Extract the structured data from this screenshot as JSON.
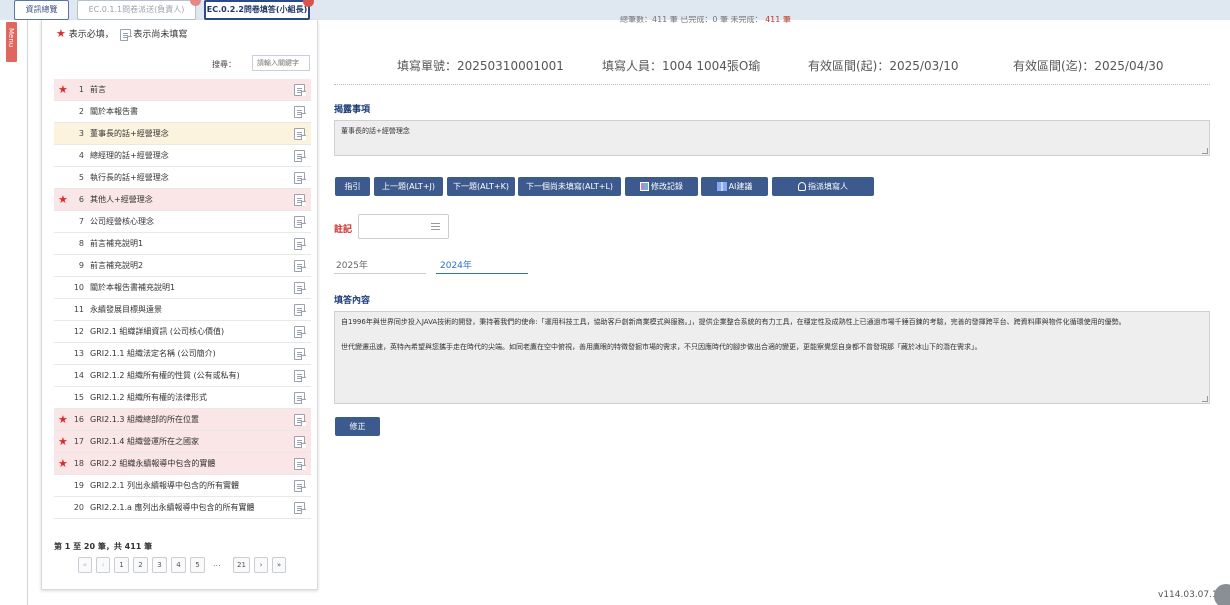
{
  "tabs": [
    {
      "label": "資訊總覽",
      "badge": false
    },
    {
      "label": "EC.0.1.1問卷派送(負責人)",
      "badge": true
    },
    {
      "label": "EC.0.2.2問卷填答(小組長)",
      "badge": true
    }
  ],
  "top_strip": {
    "text": "總筆數：411 筆 已完成：0 筆 未完成：",
    "red": "411 筆"
  },
  "menu_label": "Menu",
  "legend": {
    "required_label": "表示必填，",
    "unfilled_label": "表示尚未填寫"
  },
  "search": {
    "label": "搜尋：",
    "placeholder": "請輸入關鍵字"
  },
  "questions": [
    {
      "num": "1",
      "title": "前言",
      "required": true,
      "selected": false
    },
    {
      "num": "2",
      "title": "關於本報告書",
      "required": false,
      "selected": false
    },
    {
      "num": "3",
      "title": "董事長的話+經營理念",
      "required": false,
      "selected": true
    },
    {
      "num": "4",
      "title": "總經理的話+經營理念",
      "required": false,
      "selected": false
    },
    {
      "num": "5",
      "title": "執行長的話+經營理念",
      "required": false,
      "selected": false
    },
    {
      "num": "6",
      "title": "其他人+經營理念",
      "required": true,
      "selected": false
    },
    {
      "num": "7",
      "title": "公司經營核心理念",
      "required": false,
      "selected": false
    },
    {
      "num": "8",
      "title": "前言補充說明1",
      "required": false,
      "selected": false
    },
    {
      "num": "9",
      "title": "前言補充說明2",
      "required": false,
      "selected": false
    },
    {
      "num": "10",
      "title": "關於本報告書補充說明1",
      "required": false,
      "selected": false
    },
    {
      "num": "11",
      "title": "永續發展目標與遠景",
      "required": false,
      "selected": false
    },
    {
      "num": "12",
      "title": "GRI2.1 組織詳細資訊 (公司核心價值)",
      "required": false,
      "selected": false
    },
    {
      "num": "13",
      "title": "GRI2.1.1 組織法定名稱 (公司簡介)",
      "required": false,
      "selected": false
    },
    {
      "num": "14",
      "title": "GRI2.1.2 組織所有權的性質 (公有或私有)",
      "required": false,
      "selected": false
    },
    {
      "num": "15",
      "title": "GRI2.1.2 組織所有權的法律形式",
      "required": false,
      "selected": false
    },
    {
      "num": "16",
      "title": "GRI2.1.3 組織總部的所在位置",
      "required": true,
      "selected": false
    },
    {
      "num": "17",
      "title": "GRI2.1.4 組織營運所在之國家",
      "required": true,
      "selected": false
    },
    {
      "num": "18",
      "title": "GRI2.2 組織永續報導中包含的實體",
      "required": true,
      "selected": false
    },
    {
      "num": "19",
      "title": "GRI2.2.1 列出永續報導中包含的所有實體",
      "required": false,
      "selected": false
    },
    {
      "num": "20",
      "title": "GRI2.2.1.a 應列出永續報導中包含的所有實體",
      "required": false,
      "selected": false
    }
  ],
  "pager": {
    "info": "第 1 至 20 筆，共 411 筆",
    "first": "«",
    "prev": "‹",
    "pages": [
      "1",
      "2",
      "3",
      "4",
      "5"
    ],
    "ellipsis": "...",
    "last_page": "21",
    "next": "›",
    "last": "»"
  },
  "header_info": {
    "form_no": "填寫單號：20250310001001",
    "filler": "填寫人員：1004 1004張O瑜",
    "valid_from": "有效區間(起)：2025/03/10",
    "valid_to": "有效區間(迄)：2025/04/30"
  },
  "disclosure": {
    "title": "揭露事項",
    "text": "董事長的話+經營理念"
  },
  "buttons": {
    "guide": "指引",
    "prev": "上一題(ALT+J)",
    "next": "下一題(ALT+K)",
    "next_unfilled": "下一個尚未填寫(ALT+L)",
    "history": "修改記錄",
    "ai": "AI建議",
    "assign": "指派填寫人"
  },
  "note": {
    "label": "註記"
  },
  "year_tabs": [
    {
      "label": "2025年",
      "active": false
    },
    {
      "label": "2024年",
      "active": true
    }
  ],
  "answer": {
    "title": "填答內容",
    "paragraph1": "自1996年與世界同步投入JAVA技術的開發，秉持著我們的使命:「運用科技工具，協助客戶創新商業模式與服務。」，提供企業整合系統的有力工具，在穩定性及成熟性上已通過市場千錘百鍊的考驗，完善的發揮跨平台、跨資料庫與物件化循環使用的優勢。",
    "paragraph2": "世代變遷迅速，英特內希望與您攜手走在時代的尖端。如同老鷹在空中俯視，善用鷹眼的特徵發掘市場的需求，不只因應時代的腳步做出合適的變更，更能察覺您自身都不曾發現那「藏於冰山下的潛在需求」。"
  },
  "correct_button": "修正",
  "version": "v114.03.07.1",
  "colors": {
    "primary": "#3c5a8d",
    "required_bg": "#fae6e6",
    "selected_bg": "#fbf3dd",
    "accent_red": "#e02a2a",
    "active_tab": "#2f6fcf"
  }
}
